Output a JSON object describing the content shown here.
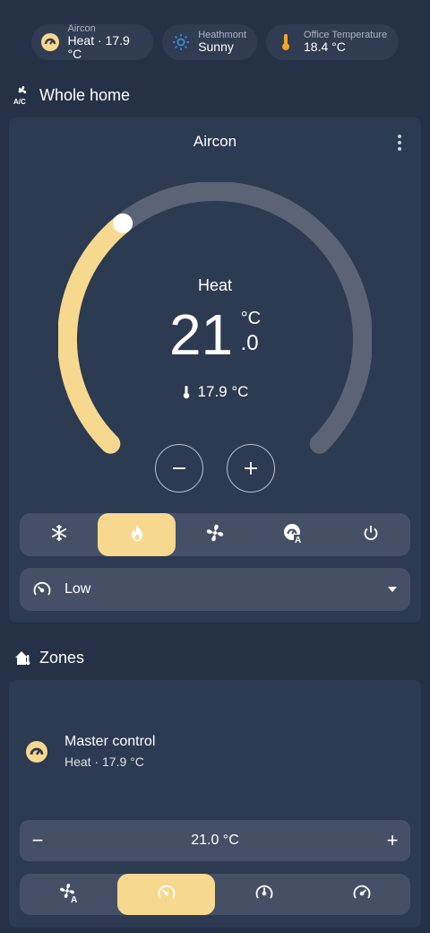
{
  "chips": [
    {
      "label": "Aircon",
      "value": "Heat · 17.9 °C",
      "icon": "aircon-icon"
    },
    {
      "label": "Heathmont",
      "value": "Sunny",
      "icon": "sunny-icon"
    },
    {
      "label": "Office Temperature",
      "value": "18.4 °C",
      "icon": "thermometer-icon"
    }
  ],
  "whole_home": {
    "title": "Whole home",
    "icon": "air-conditioner-icon",
    "card": {
      "title": "Aircon",
      "mode_label": "Heat",
      "target_whole": "21",
      "target_unit": "°C",
      "target_decimal": ".0",
      "current_temp": "17.9 °C",
      "dial": {
        "min": 16,
        "max": 30,
        "target": 21.0,
        "current": 17.9
      },
      "modes": [
        {
          "name": "cool",
          "icon": "snowflake-icon",
          "active": false
        },
        {
          "name": "heat",
          "icon": "flame-icon",
          "active": true
        },
        {
          "name": "fan_only",
          "icon": "fan-icon",
          "active": false
        },
        {
          "name": "auto",
          "icon": "thermostat-auto-icon",
          "active": false
        },
        {
          "name": "off",
          "icon": "power-icon",
          "active": false
        }
      ],
      "fan_mode": "Low"
    }
  },
  "zones": {
    "title": "Zones",
    "icon": "home-thermometer-icon",
    "master": {
      "name": "Master control",
      "state": "Heat · 17.9 °C",
      "setpoint": "21.0 °C",
      "minus": "−",
      "plus": "+"
    },
    "fan_speeds": [
      {
        "name": "auto",
        "icon": "fan-auto-icon",
        "active": false
      },
      {
        "name": "low",
        "icon": "speedometer-slow-icon",
        "active": true
      },
      {
        "name": "medium",
        "icon": "speedometer-medium-icon",
        "active": false
      },
      {
        "name": "high",
        "icon": "speedometer-icon",
        "active": false
      }
    ]
  },
  "colors": {
    "background": "#253146",
    "card": "#2c3a52",
    "accent": "#f6d88f",
    "control": "#455067",
    "track": "#5b6476"
  }
}
